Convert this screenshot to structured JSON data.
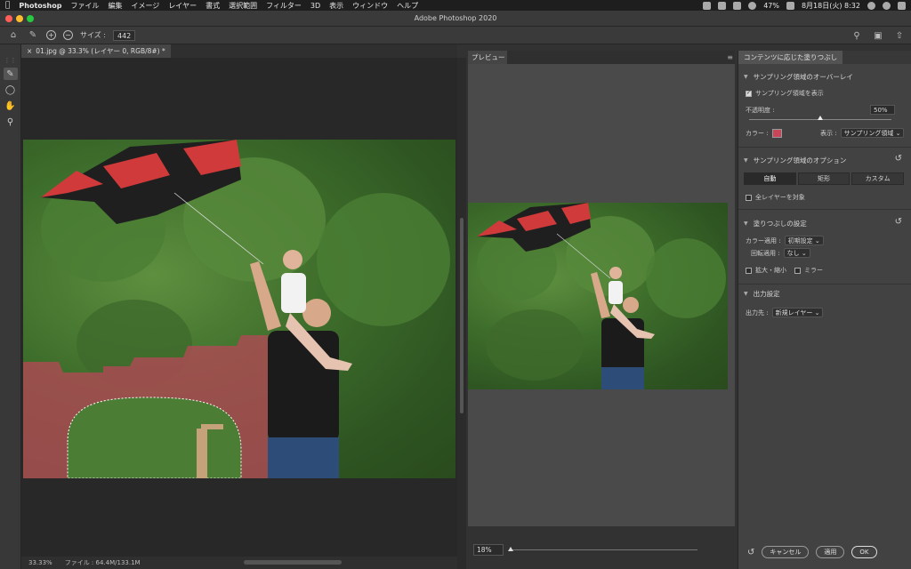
{
  "menubar": {
    "app": "Photoshop",
    "items": [
      "ファイル",
      "編集",
      "イメージ",
      "レイヤー",
      "書式",
      "選択範囲",
      "フィルター",
      "3D",
      "表示",
      "ウィンドウ",
      "ヘルプ"
    ],
    "battery": "47%",
    "datetime": "8月18日(火) 8:32"
  },
  "window": {
    "title": "Adobe Photoshop 2020"
  },
  "options_bar": {
    "size_label": "サイズ :",
    "size_value": "442"
  },
  "document": {
    "tab_title": "01.jpg @ 33.3% (レイヤー 0, RGB/8#) *",
    "zoom": "33.33%",
    "file_info": "ファイル : 64.4M/133.1M"
  },
  "preview": {
    "tab_label": "プレビュー",
    "zoom_value": "18%",
    "zoom_fraction": 0.0
  },
  "panel": {
    "tab_title": "コンテンツに応じた塗りつぶし",
    "overlay": {
      "header": "サンプリング領域のオーバーレイ",
      "show_label": "サンプリング領域を表示",
      "show_checked": true,
      "opacity_label": "不透明度 :",
      "opacity_value": "50%",
      "opacity_fraction": 0.5,
      "color_label": "カラー :",
      "color": "#c8465a",
      "display_label": "表示 :",
      "display_value": "サンプリング領域"
    },
    "sampling": {
      "header": "サンプリング領域のオプション",
      "modes": [
        "自動",
        "矩形",
        "カスタム"
      ],
      "active_mode": 0,
      "all_layers_label": "全レイヤーを対象"
    },
    "fill": {
      "header": "塗りつぶしの設定",
      "color_adapt_label": "カラー適用 :",
      "color_adapt_value": "初期設定",
      "rotation_label": "回転適用 :",
      "rotation_value": "なし",
      "scale_label": "拡大・縮小",
      "mirror_label": "ミラー"
    },
    "output": {
      "header": "出力設定",
      "output_label": "出力先 :",
      "output_value": "新規レイヤー"
    },
    "buttons": {
      "cancel": "キャンセル",
      "apply": "適用",
      "ok": "OK"
    }
  },
  "colors": {
    "sampling_overlay": "#b04a55",
    "kite_red": "#d03a3a",
    "sky": "#ffffff"
  }
}
